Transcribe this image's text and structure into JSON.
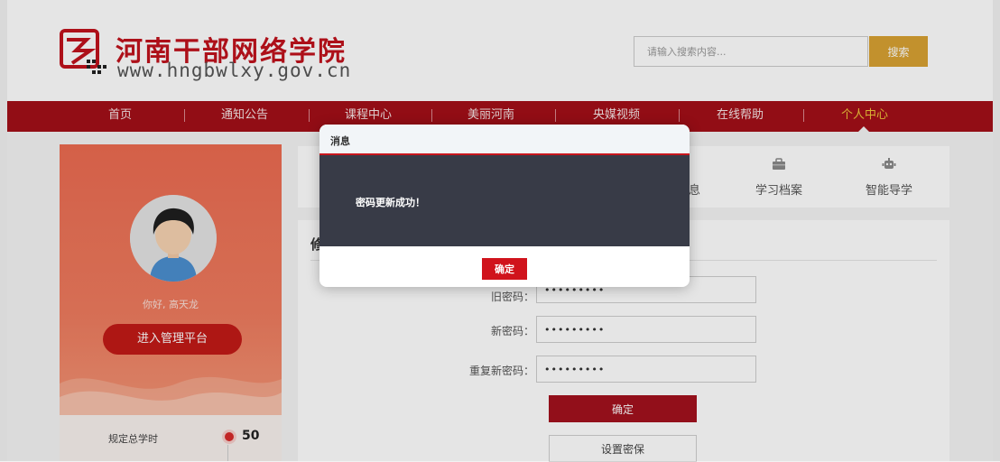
{
  "header": {
    "site_title": "河南干部网络学院",
    "site_url": "www.hngbwlxy.gov.cn",
    "search_placeholder": "请输入搜索内容...",
    "search_button": "搜索"
  },
  "nav": {
    "items": [
      "首页",
      "通知公告",
      "课程中心",
      "美丽河南",
      "央媒视频",
      "在线帮助",
      "个人中心"
    ],
    "active": "个人中心"
  },
  "profile": {
    "greeting": "你好, 高天龙",
    "manage_button": "进入管理平台",
    "required_hours_label": "规定总学时",
    "required_hours_value": "50"
  },
  "tabs": {
    "partial_label": "息",
    "items": [
      "学习档案",
      "智能导学"
    ]
  },
  "form": {
    "title_partial": "修",
    "old_password_label": "旧密码：",
    "new_password_label": "新密码：",
    "repeat_password_label": "重复新密码：",
    "old_password_value": "•••••••••",
    "new_password_value": "•••••••••",
    "repeat_password_value": "•••••••••",
    "confirm_button": "确定",
    "set_question_button": "设置密保"
  },
  "dialog": {
    "title": "消息",
    "message": "密码更新成功！",
    "ok_button": "确定"
  },
  "colors": {
    "brand_red": "#a30f18",
    "nav_active": "#f0c53a",
    "search_button": "#d8a233",
    "dialog_body": "#383b47"
  }
}
